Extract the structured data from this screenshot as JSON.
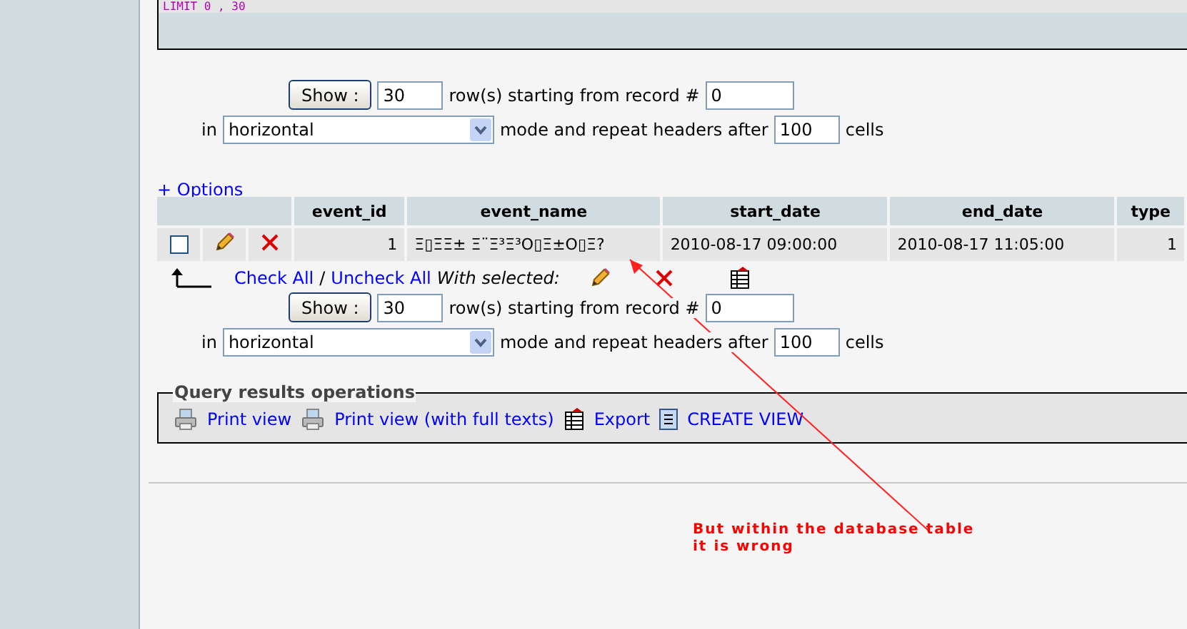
{
  "sql_box": {
    "text": "LIMIT 0 , 30"
  },
  "navigation": [
    {
      "show_button": "Show :",
      "rows": "30",
      "rows_label": "row(s) starting from record #",
      "start": "0",
      "in_label": "in",
      "mode": "horizontal",
      "mode_label": "mode and repeat headers after",
      "repeat": "100",
      "cells_label": "cells"
    },
    {
      "show_button": "Show :",
      "rows": "30",
      "rows_label": "row(s) starting from record #",
      "start": "0",
      "in_label": "in",
      "mode": "horizontal",
      "mode_label": "mode and repeat headers after",
      "repeat": "100",
      "cells_label": "cells"
    }
  ],
  "options_link": "+ Options",
  "table": {
    "columns": [
      "event_id",
      "event_name",
      "start_date",
      "end_date",
      "type"
    ],
    "rows": [
      {
        "checked": false,
        "cells": [
          "1",
          "Ξ▯ΞΞ± Ξ¨Ξ³Ξ³Ο▯Ξ±Ο▯Ξ?",
          "2010-08-17 09:00:00",
          "2010-08-17 11:05:00",
          "1"
        ]
      }
    ]
  },
  "bulk": {
    "check_all": "Check All",
    "separator": "/",
    "uncheck_all": "Uncheck All",
    "with_selected": "With selected:"
  },
  "operations": {
    "legend": "Query results operations",
    "links": [
      {
        "kind": "print",
        "label": "Print view"
      },
      {
        "kind": "print",
        "label": "Print view (with full texts)"
      },
      {
        "kind": "export",
        "label": "Export"
      },
      {
        "kind": "view",
        "label": "CREATE VIEW"
      }
    ]
  },
  "annotation": {
    "text": "But within the database table it is wrong"
  }
}
